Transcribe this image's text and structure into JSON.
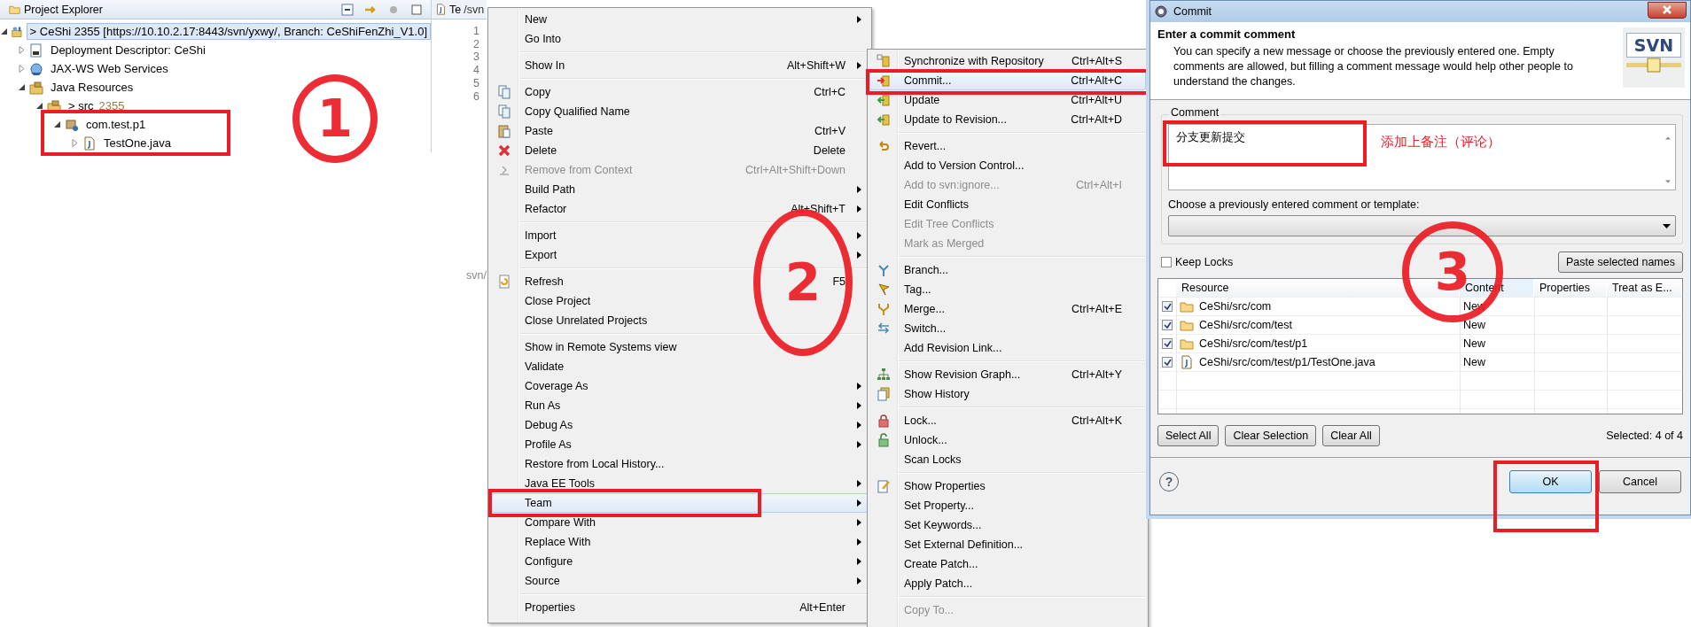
{
  "project_explorer": {
    "title": "Project Explorer",
    "tree": [
      {
        "label": "> CeShi 2355 [https://10.10.2.17:8443/svn/yxwy/, Branch: CeShiFenZhi_V1.0]",
        "kind": "project",
        "expanded": true,
        "selected": true,
        "children": [
          {
            "label": "Deployment Descriptor: CeShi",
            "kind": "descriptor",
            "expanded": false,
            "selected": false
          },
          {
            "label": "JAX-WS Web Services",
            "kind": "webservices",
            "expanded": false,
            "selected": false
          },
          {
            "label": "Java Resources",
            "kind": "resources",
            "expanded": true,
            "selected": false,
            "children": [
              {
                "label": "> src",
                "revision": "2355",
                "kind": "source",
                "expanded": true,
                "selected": false,
                "children": [
                  {
                    "label": "com.test.p1",
                    "kind": "package",
                    "expanded": true,
                    "selected": false,
                    "highlighted": true,
                    "children": [
                      {
                        "label": "TestOne.java",
                        "kind": "java",
                        "expanded": false,
                        "selected": false
                      }
                    ]
                  }
                ]
              }
            ]
          }
        ]
      }
    ]
  },
  "editor": {
    "tab": "Te",
    "tab_fragment": "/svn",
    "line_numbers": [
      "1",
      "2",
      "3",
      "4",
      "5",
      "6"
    ],
    "text_fragment": "svn/"
  },
  "context_menu": {
    "groups": [
      [
        {
          "label": "New",
          "submenu": true
        },
        {
          "label": "Go Into"
        }
      ],
      [
        {
          "label": "Show In",
          "shortcut": "Alt+Shift+W",
          "submenu": true
        }
      ],
      [
        {
          "label": "Copy",
          "shortcut": "Ctrl+C",
          "kind": "copy"
        },
        {
          "label": "Copy Qualified Name",
          "kind": "copy"
        },
        {
          "label": "Paste",
          "shortcut": "Ctrl+V",
          "kind": "paste"
        },
        {
          "label": "Delete",
          "shortcut": "Delete",
          "kind": "delete"
        },
        {
          "label": "Remove from Context",
          "shortcut": "Ctrl+Alt+Shift+Down",
          "kind": "remove",
          "disabled": true
        },
        {
          "label": "Build Path",
          "submenu": true
        },
        {
          "label": "Refactor",
          "shortcut": "Alt+Shift+T",
          "submenu": true
        }
      ],
      [
        {
          "label": "Import",
          "submenu": true
        },
        {
          "label": "Export",
          "submenu": true
        }
      ],
      [
        {
          "label": "Refresh",
          "shortcut": "F5",
          "kind": "refresh"
        },
        {
          "label": "Close Project"
        },
        {
          "label": "Close Unrelated Projects"
        }
      ],
      [
        {
          "label": "Show in Remote Systems view"
        },
        {
          "label": "Validate"
        },
        {
          "label": "Coverage As",
          "submenu": true
        },
        {
          "label": "Run As",
          "submenu": true
        },
        {
          "label": "Debug As",
          "submenu": true
        },
        {
          "label": "Profile As",
          "submenu": true
        },
        {
          "label": "Restore from Local History..."
        },
        {
          "label": "Java EE Tools",
          "submenu": true
        },
        {
          "label": "Team",
          "submenu": true,
          "selected": true,
          "highlighted": true
        },
        {
          "label": "Compare With",
          "submenu": true
        },
        {
          "label": "Replace With",
          "submenu": true
        },
        {
          "label": "Configure",
          "submenu": true
        },
        {
          "label": "Source",
          "submenu": true
        }
      ],
      [
        {
          "label": "Properties",
          "shortcut": "Alt+Enter"
        }
      ]
    ]
  },
  "team_menu": {
    "groups": [
      [
        {
          "label": "Synchronize with Repository",
          "shortcut": "Ctrl+Alt+S",
          "kind": "sync"
        },
        {
          "label": "Commit...",
          "shortcut": "Ctrl+Alt+C",
          "kind": "commit",
          "selected": true,
          "highlighted": true
        },
        {
          "label": "Update",
          "shortcut": "Ctrl+Alt+U",
          "kind": "update"
        },
        {
          "label": "Update to Revision...",
          "shortcut": "Ctrl+Alt+D",
          "kind": "update"
        }
      ],
      [
        {
          "label": "Revert...",
          "kind": "revert"
        },
        {
          "label": "Add to Version Control..."
        },
        {
          "label": "Add to svn:ignore...",
          "shortcut": "Ctrl+Alt+I",
          "disabled": true
        },
        {
          "label": "Edit Conflicts"
        },
        {
          "label": "Edit Tree Conflicts",
          "disabled": true
        },
        {
          "label": "Mark as Merged",
          "disabled": true
        }
      ],
      [
        {
          "label": "Branch...",
          "kind": "branch"
        },
        {
          "label": "Tag...",
          "kind": "tag"
        },
        {
          "label": "Merge...",
          "shortcut": "Ctrl+Alt+E",
          "kind": "merge"
        },
        {
          "label": "Switch...",
          "kind": "switch"
        },
        {
          "label": "Add Revision Link..."
        }
      ],
      [
        {
          "label": "Show Revision Graph...",
          "shortcut": "Ctrl+Alt+Y",
          "kind": "graph"
        },
        {
          "label": "Show History",
          "kind": "history"
        }
      ],
      [
        {
          "label": "Lock...",
          "shortcut": "Ctrl+Alt+K",
          "kind": "lock"
        },
        {
          "label": "Unlock...",
          "kind": "unlock"
        },
        {
          "label": "Scan Locks"
        }
      ],
      [
        {
          "label": "Show Properties",
          "kind": "properties"
        },
        {
          "label": "Set Property..."
        },
        {
          "label": "Set Keywords..."
        },
        {
          "label": "Set External Definition..."
        },
        {
          "label": "Create Patch..."
        },
        {
          "label": "Apply Patch..."
        }
      ],
      [
        {
          "label": "Copy To...",
          "disabled": true
        }
      ]
    ]
  },
  "dialog": {
    "title": "Commit",
    "heading": "Enter a commit comment",
    "description": "You can specify a new message or choose the previously entered one. Empty comments are allowed, but filling a comment message would help other people to understand the changes.",
    "logo": "SVN",
    "comment_label": "Comment",
    "comment": "分支更新提交",
    "comment_highlighted": true,
    "annotation": "添加上备注（评论）",
    "template_label": "Choose a previously entered comment or template:",
    "keep_locks": {
      "label": "Keep Locks",
      "checked": false
    },
    "paste_button": "Paste selected names",
    "table": {
      "columns": [
        "Resource",
        "Content",
        "Properties",
        "Treat as E..."
      ],
      "rows": [
        {
          "checked": true,
          "kind": "folder",
          "resource": "CeShi/src/com",
          "content": "New"
        },
        {
          "checked": true,
          "kind": "folder",
          "resource": "CeShi/src/com/test",
          "content": "New"
        },
        {
          "checked": true,
          "kind": "folder",
          "resource": "CeShi/src/com/test/p1",
          "content": "New"
        },
        {
          "checked": true,
          "kind": "java",
          "resource": "CeShi/src/com/test/p1/TestOne.java",
          "content": "New"
        }
      ]
    },
    "selection_buttons": [
      "Select All",
      "Clear Selection",
      "Clear All"
    ],
    "selected_count": "Selected: 4 of 4",
    "help": "?",
    "buttons": [
      {
        "label": "OK",
        "default": true,
        "highlighted": true
      },
      {
        "label": "Cancel",
        "default": false,
        "highlighted": false
      }
    ]
  },
  "annotations": [
    {
      "label": "1"
    },
    {
      "label": "2"
    },
    {
      "label": "3"
    }
  ]
}
